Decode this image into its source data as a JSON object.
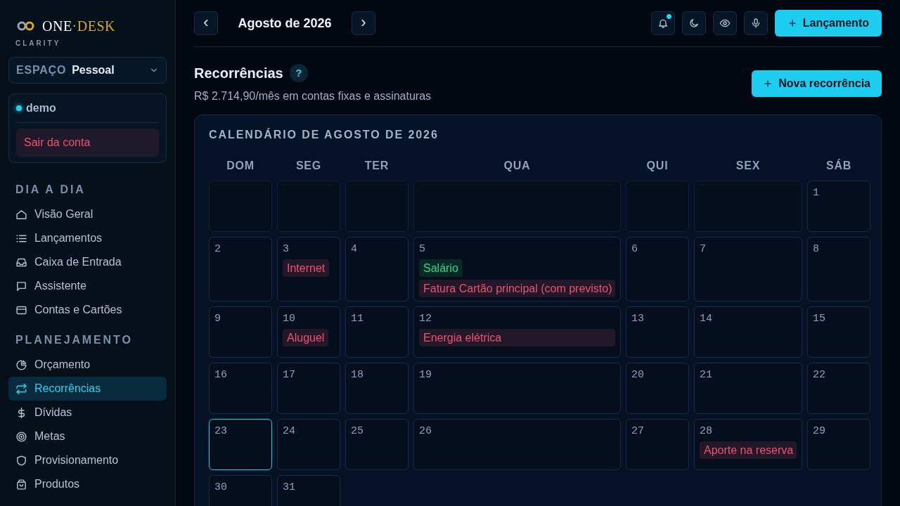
{
  "brand": {
    "name_left": "ONE",
    "separator": "·",
    "name_right": "DESK",
    "tagline": "CLARITY"
  },
  "workspace": {
    "label": "ESPAÇO",
    "value": "Pessoal"
  },
  "account": {
    "user": "demo",
    "online": true,
    "logout": "Sair da conta"
  },
  "sidebar": {
    "sections": [
      {
        "title": "DIA A DIA",
        "items": [
          {
            "label": "Visão Geral",
            "selected": false
          },
          {
            "label": "Lançamentos",
            "selected": false
          },
          {
            "label": "Caixa de Entrada",
            "selected": false
          },
          {
            "label": "Assistente",
            "selected": false
          },
          {
            "label": "Contas e Cartões",
            "selected": false
          }
        ]
      },
      {
        "title": "PLANEJAMENTO",
        "items": [
          {
            "label": "Orçamento",
            "selected": false
          },
          {
            "label": "Recorrências",
            "selected": true
          },
          {
            "label": "Dívidas",
            "selected": false
          },
          {
            "label": "Metas",
            "selected": false
          },
          {
            "label": "Provisionamento",
            "selected": false
          },
          {
            "label": "Produtos",
            "selected": false
          }
        ]
      }
    ]
  },
  "topbar": {
    "prev": "‹",
    "month": "Agosto de 2026",
    "next": "›",
    "notifications_unread": true,
    "new_button": "Lançamento"
  },
  "page": {
    "title": "Recorrências",
    "help": "?",
    "subtitle": "R$ 2.714,90/mês em contas fixas e assinaturas",
    "new_button": "Nova recorrência"
  },
  "calendar": {
    "title": "CALENDÁRIO DE AGOSTO DE 2026",
    "weekdays": [
      "DOM",
      "SEG",
      "TER",
      "QUA",
      "QUI",
      "SEX",
      "SÁB"
    ],
    "weeks": [
      [
        {
          "kind": "empty"
        },
        {
          "kind": "empty"
        },
        {
          "kind": "empty"
        },
        {
          "kind": "empty"
        },
        {
          "kind": "empty"
        },
        {
          "kind": "empty"
        },
        {
          "kind": "day",
          "day": "1",
          "today": false
        }
      ],
      [
        {
          "kind": "day",
          "day": "2",
          "today": false
        },
        {
          "kind": "day",
          "day": "3",
          "today": false,
          "events": [
            {
              "label": "Internet",
              "kind": "expense"
            }
          ]
        },
        {
          "kind": "day",
          "day": "4",
          "today": false
        },
        {
          "kind": "day",
          "day": "5",
          "today": false,
          "events": [
            {
              "label": "Salário",
              "kind": "income"
            },
            {
              "label": "Fatura Cartão principal (com previsto)",
              "kind": "expense"
            }
          ]
        },
        {
          "kind": "day",
          "day": "6",
          "today": false
        },
        {
          "kind": "day",
          "day": "7",
          "today": false
        },
        {
          "kind": "day",
          "day": "8",
          "today": false
        }
      ],
      [
        {
          "kind": "day",
          "day": "9",
          "today": false
        },
        {
          "kind": "day",
          "day": "10",
          "today": false,
          "events": [
            {
              "label": "Aluguel",
              "kind": "expense"
            }
          ]
        },
        {
          "kind": "day",
          "day": "11",
          "today": false
        },
        {
          "kind": "day",
          "day": "12",
          "today": false,
          "events": [
            {
              "label": "Energia elétrica",
              "kind": "expense"
            }
          ]
        },
        {
          "kind": "day",
          "day": "13",
          "today": false
        },
        {
          "kind": "day",
          "day": "14",
          "today": false
        },
        {
          "kind": "day",
          "day": "15",
          "today": false
        }
      ],
      [
        {
          "kind": "day",
          "day": "16",
          "today": false
        },
        {
          "kind": "day",
          "day": "17",
          "today": false
        },
        {
          "kind": "day",
          "day": "18",
          "today": false
        },
        {
          "kind": "day",
          "day": "19",
          "today": false
        },
        {
          "kind": "day",
          "day": "20",
          "today": false
        },
        {
          "kind": "day",
          "day": "21",
          "today": false
        },
        {
          "kind": "day",
          "day": "22",
          "today": false
        }
      ],
      [
        {
          "kind": "day",
          "day": "23",
          "today": true
        },
        {
          "kind": "day",
          "day": "24",
          "today": false
        },
        {
          "kind": "day",
          "day": "25",
          "today": false
        },
        {
          "kind": "day",
          "day": "26",
          "today": false
        },
        {
          "kind": "day",
          "day": "27",
          "today": false
        },
        {
          "kind": "day",
          "day": "28",
          "today": false,
          "events": [
            {
              "label": "Aporte na reserva",
              "kind": "expense"
            }
          ]
        },
        {
          "kind": "day",
          "day": "29",
          "today": false
        }
      ],
      [
        {
          "kind": "day",
          "day": "30",
          "today": false
        },
        {
          "kind": "day",
          "day": "31",
          "today": false
        }
      ]
    ]
  }
}
